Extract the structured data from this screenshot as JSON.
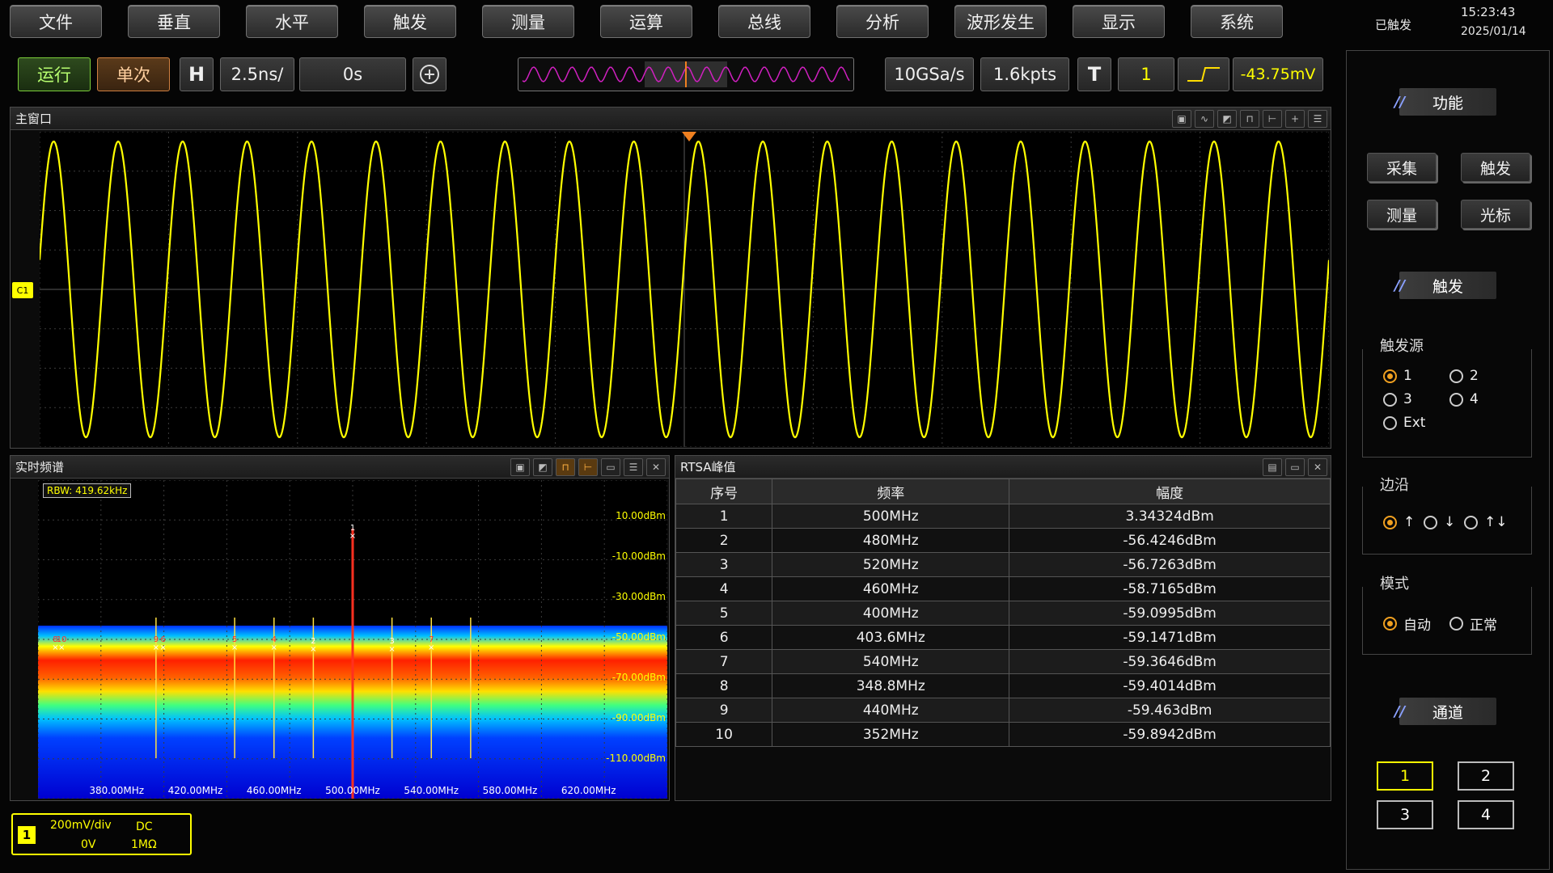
{
  "menu": [
    "文件",
    "垂直",
    "水平",
    "触发",
    "测量",
    "运算",
    "总线",
    "分析",
    "波形发生",
    "显示",
    "系统"
  ],
  "status": {
    "trigger_state": "已触发",
    "time": "15:23:43",
    "date": "2025/01/14"
  },
  "toolbar": {
    "run_label": "运行",
    "single_label": "单次",
    "h_label": "H",
    "timebase": "2.5ns/",
    "offset": "0s",
    "sample_rate": "10GSa/s",
    "memory_depth": "1.6kpts",
    "t_label": "T",
    "trigger_channel": "1",
    "trigger_level": "-43.75mV"
  },
  "main_window": {
    "title": "主窗口",
    "channel_marker": "C1"
  },
  "spectrum": {
    "title": "实时频谱",
    "rbw": "RBW: 419.62kHz",
    "y_labels": [
      "10.00dBm",
      "-10.00dBm",
      "-30.00dBm",
      "-50.00dBm",
      "-70.00dBm",
      "-90.00dBm",
      "-110.00dBm"
    ],
    "x_labels": [
      "380.00MHz",
      "420.00MHz",
      "460.00MHz",
      "500.00MHz",
      "540.00MHz",
      "580.00MHz",
      "620.00MHz"
    ],
    "peak_labels": [
      "1",
      "2",
      "3",
      "4",
      "5",
      "6",
      "7",
      "8",
      "9",
      "10"
    ]
  },
  "rtsa": {
    "title": "RTSA峰值",
    "headers": [
      "序号",
      "频率",
      "幅度"
    ],
    "rows": [
      [
        "1",
        "500MHz",
        "3.34324dBm"
      ],
      [
        "2",
        "480MHz",
        "-56.4246dBm"
      ],
      [
        "3",
        "520MHz",
        "-56.7263dBm"
      ],
      [
        "4",
        "460MHz",
        "-58.7165dBm"
      ],
      [
        "5",
        "400MHz",
        "-59.0995dBm"
      ],
      [
        "6",
        "403.6MHz",
        "-59.1471dBm"
      ],
      [
        "7",
        "540MHz",
        "-59.3646dBm"
      ],
      [
        "8",
        "348.8MHz",
        "-59.4014dBm"
      ],
      [
        "9",
        "440MHz",
        "-59.463dBm"
      ],
      [
        "10",
        "352MHz",
        "-59.8942dBm"
      ]
    ]
  },
  "channel_info": {
    "number": "1",
    "scale": "200mV/div",
    "coupling": "DC",
    "offset": "0V",
    "impedance": "1MΩ"
  },
  "sidebar": {
    "function_title": "功能",
    "buttons": [
      "采集",
      "触发",
      "测量",
      "光标"
    ],
    "trigger_title": "触发",
    "trigger_source_label": "触发源",
    "sources": [
      "1",
      "2",
      "3",
      "4",
      "Ext"
    ],
    "edge_label": "边沿",
    "edges": [
      "↑",
      "↓",
      "↑↓"
    ],
    "mode_label": "模式",
    "modes": [
      "自动",
      "正常"
    ],
    "channel_title": "通道",
    "channels": [
      "1",
      "2",
      "3",
      "4"
    ]
  },
  "colors": {
    "trace": "#ffff00",
    "accent": "#f0a020",
    "run": "#7ccf3a"
  }
}
